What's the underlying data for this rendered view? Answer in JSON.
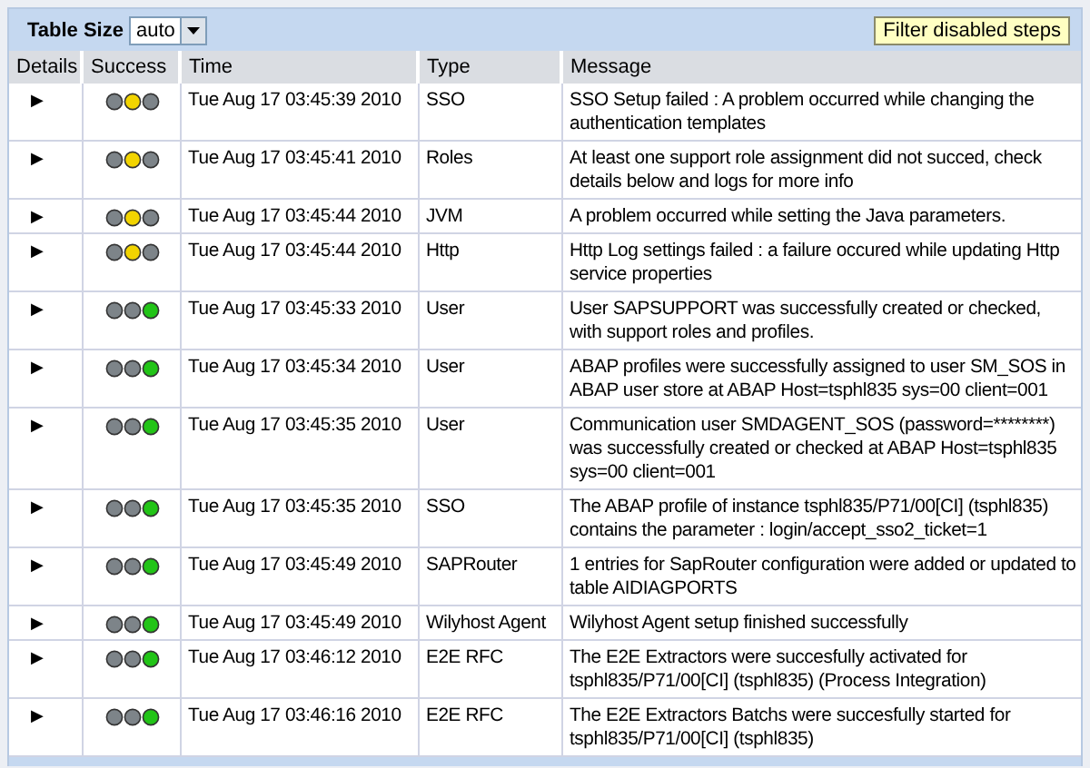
{
  "toolbar": {
    "table_size_label": "Table Size",
    "table_size_value": "auto",
    "filter_button": "Filter disabled steps"
  },
  "table": {
    "columns": [
      "Details",
      "Success",
      "Time",
      "Type",
      "Message"
    ],
    "rows": [
      {
        "expander": "▶",
        "lights": [
          {
            "color": "#7d8489"
          },
          {
            "color": "#f2d400"
          },
          {
            "color": "#7d8489"
          }
        ],
        "time": "Tue Aug 17 03:45:39 2010",
        "type": "SSO",
        "message": "SSO Setup failed : A problem occurred while changing the authentication templates"
      },
      {
        "expander": "▶",
        "lights": [
          {
            "color": "#7d8489"
          },
          {
            "color": "#f2d400"
          },
          {
            "color": "#7d8489"
          }
        ],
        "time": "Tue Aug 17 03:45:41 2010",
        "type": "Roles",
        "message": "At least one support role assignment did not succed, check details below and logs for more info"
      },
      {
        "expander": "▶",
        "lights": [
          {
            "color": "#7d8489"
          },
          {
            "color": "#f2d400"
          },
          {
            "color": "#7d8489"
          }
        ],
        "time": "Tue Aug 17 03:45:44 2010",
        "type": "JVM",
        "message": "A problem occurred while setting the Java parameters."
      },
      {
        "expander": "▶",
        "lights": [
          {
            "color": "#7d8489"
          },
          {
            "color": "#f2d400"
          },
          {
            "color": "#7d8489"
          }
        ],
        "time": "Tue Aug 17 03:45:44 2010",
        "type": "Http",
        "message": "Http Log settings failed : a failure occured while updating Http service properties"
      },
      {
        "expander": "▶",
        "lights": [
          {
            "color": "#7d8489"
          },
          {
            "color": "#7d8489"
          },
          {
            "color": "#22c417"
          }
        ],
        "time": "Tue Aug 17 03:45:33 2010",
        "type": "User",
        "message": "User SAPSUPPORT was successfully created or checked, with support roles and profiles."
      },
      {
        "expander": "▶",
        "lights": [
          {
            "color": "#7d8489"
          },
          {
            "color": "#7d8489"
          },
          {
            "color": "#22c417"
          }
        ],
        "time": "Tue Aug 17 03:45:34 2010",
        "type": "User",
        "message": "ABAP profiles were successfully assigned to user SM_SOS in ABAP user store at ABAP Host=tsphl835 sys=00 client=001"
      },
      {
        "expander": "▶",
        "lights": [
          {
            "color": "#7d8489"
          },
          {
            "color": "#7d8489"
          },
          {
            "color": "#22c417"
          }
        ],
        "time": "Tue Aug 17 03:45:35 2010",
        "type": "User",
        "message": "Communication user SMDAGENT_SOS (password=********) was successfully created or checked at ABAP Host=tsphl835 sys=00 client=001"
      },
      {
        "expander": "▶",
        "lights": [
          {
            "color": "#7d8489"
          },
          {
            "color": "#7d8489"
          },
          {
            "color": "#22c417"
          }
        ],
        "time": "Tue Aug 17 03:45:35 2010",
        "type": "SSO",
        "message": "The ABAP profile of instance tsphl835/P71/00[CI] (tsphl835) contains the parameter : login/accept_sso2_ticket=1"
      },
      {
        "expander": "▶",
        "lights": [
          {
            "color": "#7d8489"
          },
          {
            "color": "#7d8489"
          },
          {
            "color": "#22c417"
          }
        ],
        "time": "Tue Aug 17 03:45:49 2010",
        "type": "SAPRouter",
        "message": "1 entries for SapRouter configuration were added or updated to table AIDIAGPORTS"
      },
      {
        "expander": "▶",
        "lights": [
          {
            "color": "#7d8489"
          },
          {
            "color": "#7d8489"
          },
          {
            "color": "#22c417"
          }
        ],
        "time": "Tue Aug 17 03:45:49 2010",
        "type": "Wilyhost Agent",
        "message": "Wilyhost Agent setup finished successfully"
      },
      {
        "expander": "▶",
        "lights": [
          {
            "color": "#7d8489"
          },
          {
            "color": "#7d8489"
          },
          {
            "color": "#22c417"
          }
        ],
        "time": "Tue Aug 17 03:46:12 2010",
        "type": "E2E RFC",
        "message": "The E2E Extractors were succesfully activated for tsphl835/P71/00[CI] (tsphl835) (Process Integration)"
      },
      {
        "expander": "▶",
        "lights": [
          {
            "color": "#7d8489"
          },
          {
            "color": "#7d8489"
          },
          {
            "color": "#22c417"
          }
        ],
        "time": "Tue Aug 17 03:46:16 2010",
        "type": "E2E RFC",
        "message": "The E2E Extractors Batchs were succesfully started for tsphl835/P71/00[CI] (tsphl835)"
      }
    ]
  }
}
